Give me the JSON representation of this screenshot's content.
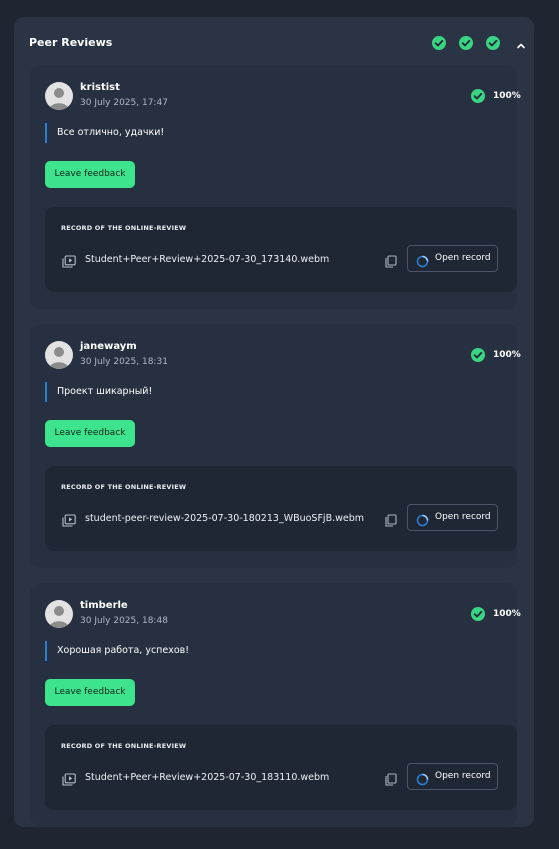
{
  "panel": {
    "title": "Peer Reviews",
    "header_checks": 3,
    "collapse_icon": "chevron-up-icon"
  },
  "colors": {
    "accent_green": "#3ee38d",
    "check_green": "#3ad483",
    "comment_bar_blue": "#2a7fd4",
    "panel_bg": "#2b3444",
    "card_bg": "#273040",
    "record_bg": "#1f2735"
  },
  "reviews": [
    {
      "username": "kristist",
      "date": "30 July 2025, 17:47",
      "score": "100%",
      "comment": "Все отлично, удачки!",
      "feedback_label": "Leave feedback",
      "record_label": "RECORD OF THE ONLINE-REVIEW",
      "file_name": "Student+Peer+Review+2025-07-30_173140.webm",
      "open_label": "Open record"
    },
    {
      "username": "janewaym",
      "date": "30 July 2025, 18:31",
      "score": "100%",
      "comment": "Проект шикарный!",
      "feedback_label": "Leave feedback",
      "record_label": "RECORD OF THE ONLINE-REVIEW",
      "file_name": "student-peer-review-2025-07-30-180213_WBuoSFjB.webm",
      "open_label": "Open record"
    },
    {
      "username": "timberle",
      "date": "30 July 2025, 18:48",
      "score": "100%",
      "comment": "Хорошая работа, успехов!",
      "feedback_label": "Leave feedback",
      "record_label": "RECORD OF THE ONLINE-REVIEW",
      "file_name": "Student+Peer+Review+2025-07-30_183110.webm",
      "open_label": "Open record"
    }
  ]
}
